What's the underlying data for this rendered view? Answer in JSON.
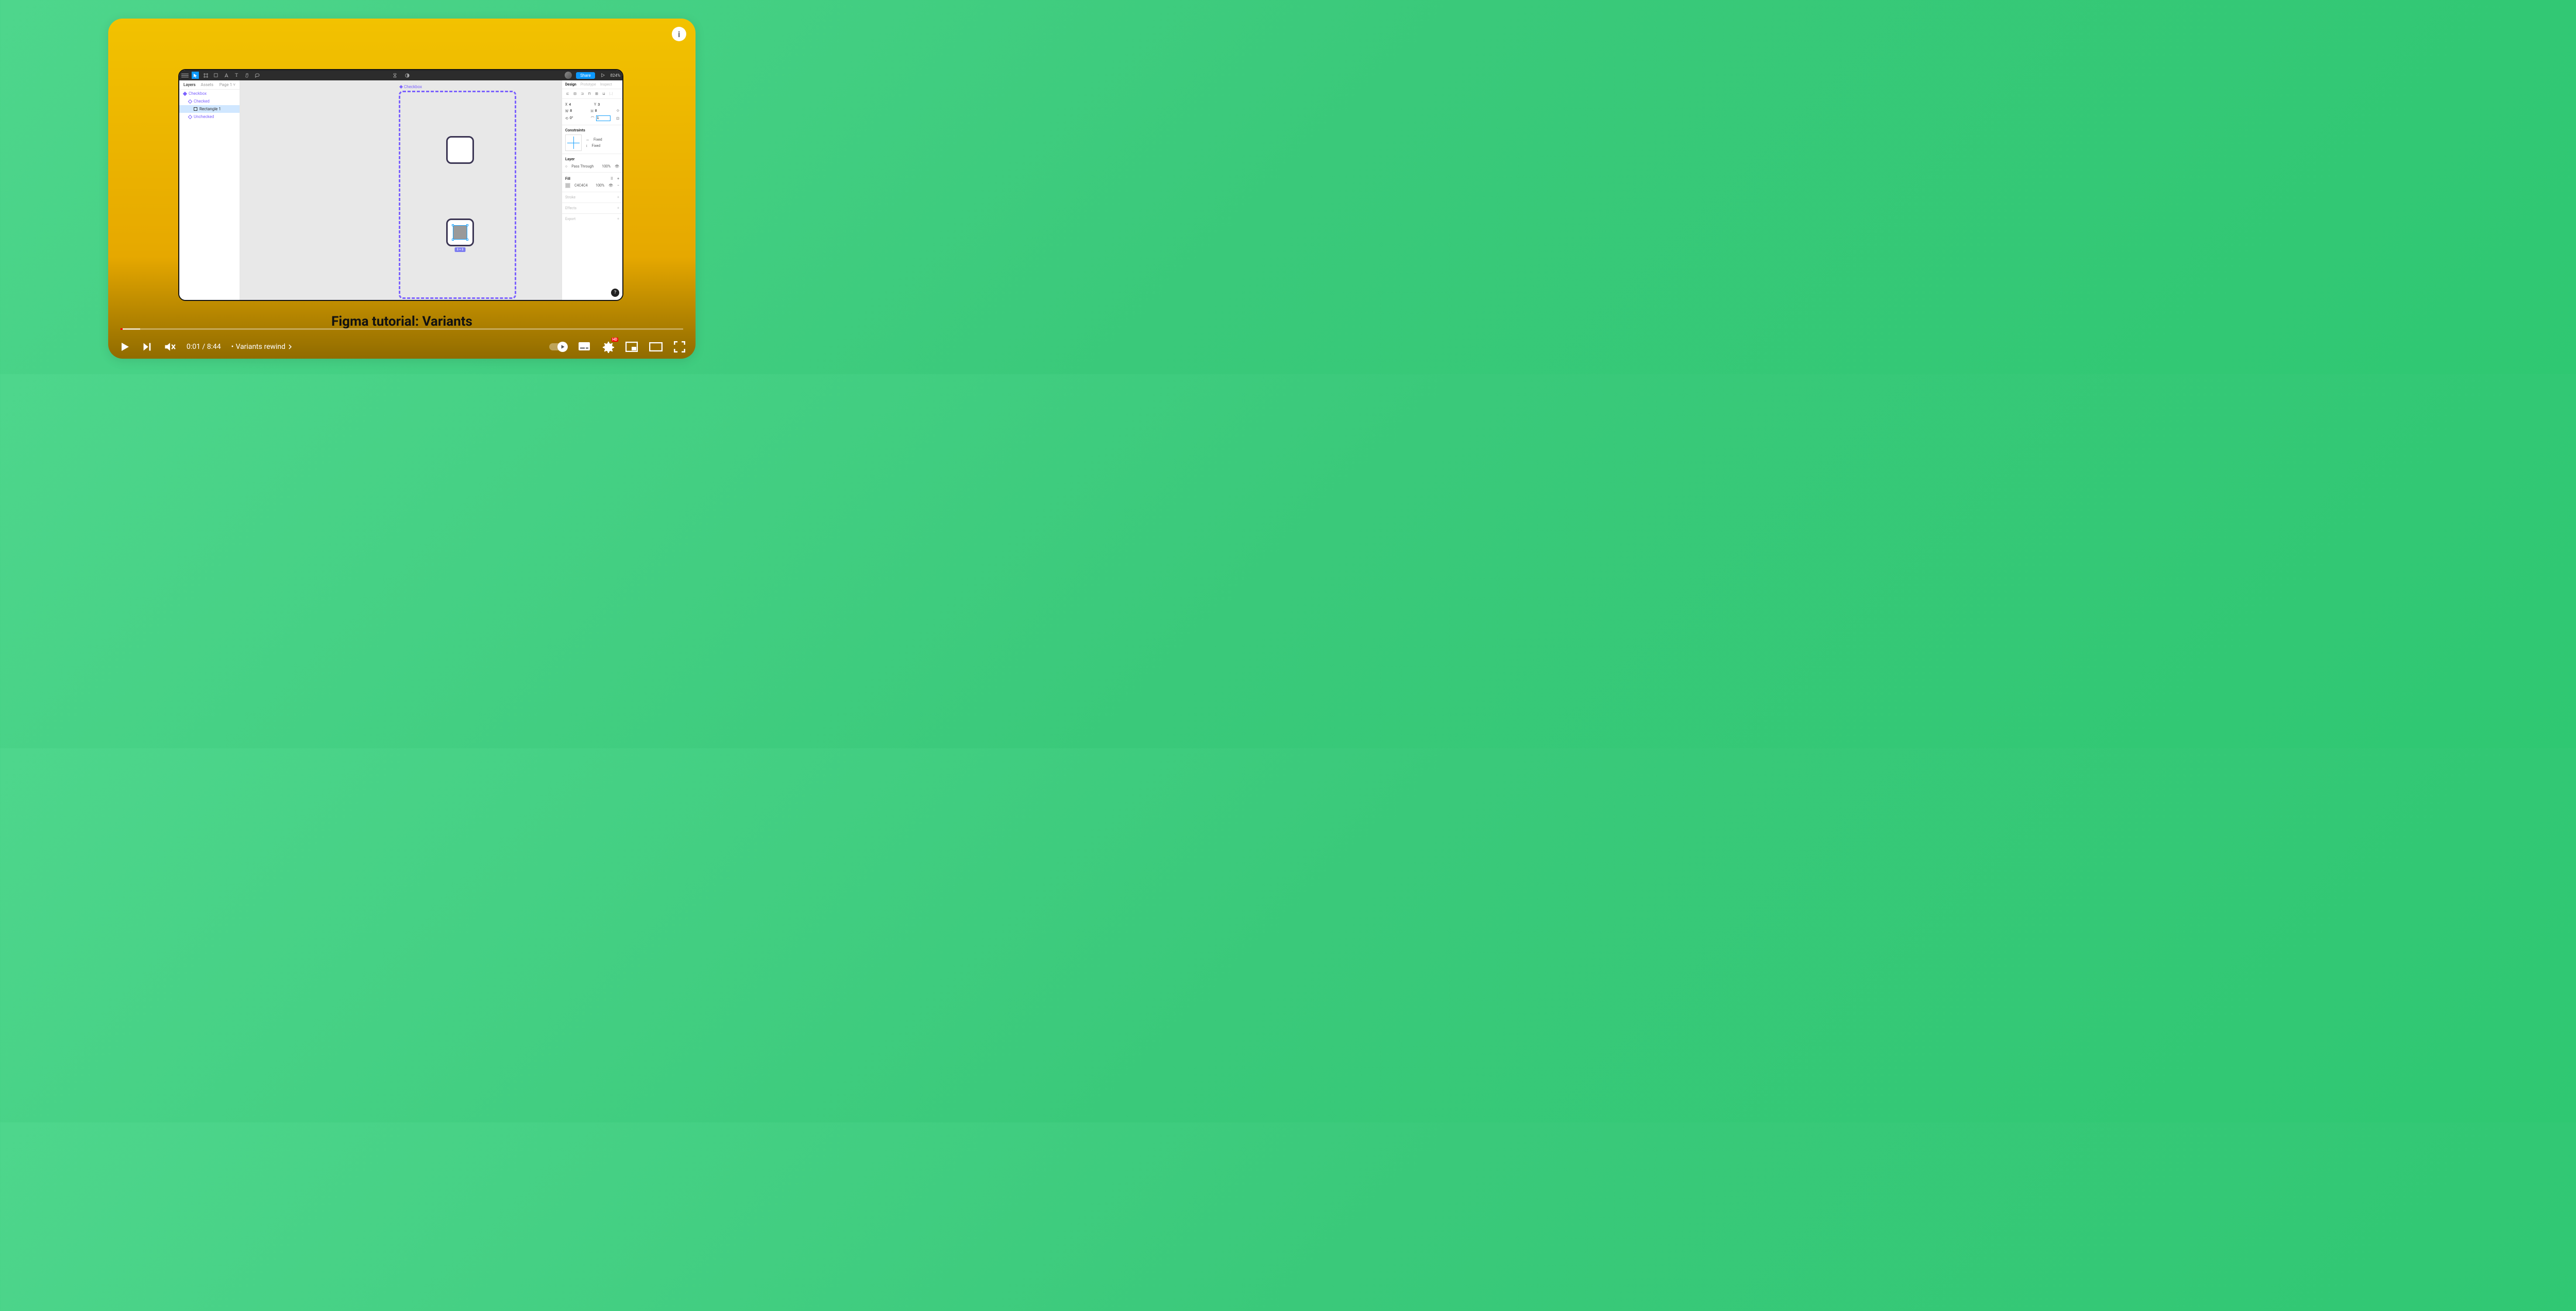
{
  "video": {
    "title": "Figma tutorial: Variants",
    "current_time": "0:01",
    "duration": "8:44",
    "chapter": "Variants rewind",
    "hd_badge": "HD",
    "info_label": "i"
  },
  "figma": {
    "toolbar": {
      "share": "Share",
      "zoom": "824%"
    },
    "left_panel": {
      "tabs": {
        "layers": "Layers",
        "assets": "Assets",
        "page": "Page 1"
      },
      "items": {
        "component": "Checkbox",
        "checked": "Checked",
        "rectangle": "Rectangle 1",
        "unchecked": "Unchecked"
      }
    },
    "canvas": {
      "label": "Checkbox",
      "dim_badge": "8 × 8"
    },
    "right_panel": {
      "tabs": {
        "design": "Design",
        "prototype": "Prototype",
        "inspect": "Inspect"
      },
      "coords": {
        "x_label": "X",
        "x": "4",
        "y_label": "Y",
        "y": "3"
      },
      "size": {
        "w_label": "W",
        "w": "8",
        "h_label": "H",
        "h": "8"
      },
      "rotation": "0°",
      "radius": "1",
      "constraints": {
        "title": "Constraints",
        "fixed1": "Fixed",
        "fixed2": "Fixed"
      },
      "layer": {
        "title": "Layer",
        "blend": "Pass Through",
        "opacity": "100%"
      },
      "fill": {
        "title": "Fill",
        "hex": "C4C4C4",
        "opacity": "100%"
      },
      "stroke": "Stroke",
      "effects": "Effects",
      "export": "Export",
      "help": "?"
    }
  }
}
